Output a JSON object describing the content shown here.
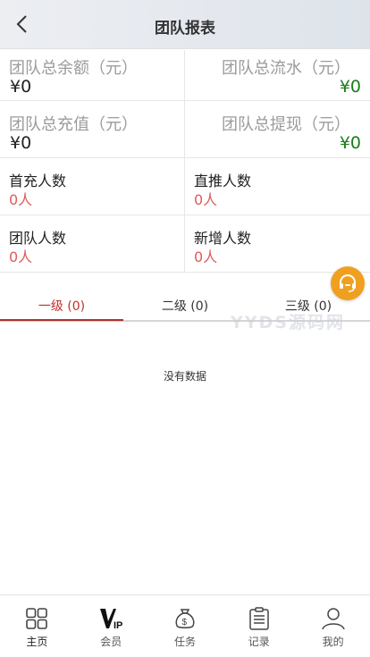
{
  "header": {
    "title": "团队报表"
  },
  "money_stats": [
    {
      "label": "团队总余额（元）",
      "value": "¥0"
    },
    {
      "label": "团队总流水（元）",
      "value": "¥0"
    },
    {
      "label": "团队总充值（元）",
      "value": "¥0"
    },
    {
      "label": "团队总提现（元）",
      "value": "¥0"
    }
  ],
  "count_stats": [
    {
      "label": "首充人数",
      "value": "0人"
    },
    {
      "label": "直推人数",
      "value": "0人"
    },
    {
      "label": "团队人数",
      "value": "0人"
    },
    {
      "label": "新增人数",
      "value": "0人"
    }
  ],
  "tabs": [
    {
      "label": "一级 (0)",
      "active": true
    },
    {
      "label": "二级 (0)",
      "active": false
    },
    {
      "label": "三级 (0)",
      "active": false
    }
  ],
  "watermark": "YYDS源码网",
  "empty_text": "没有数据",
  "tabbar": [
    {
      "label": "主页",
      "icon": "grid-icon",
      "active": true
    },
    {
      "label": "会员",
      "icon": "vip-icon",
      "active": false
    },
    {
      "label": "任务",
      "icon": "money-bag-icon",
      "active": false
    },
    {
      "label": "记录",
      "icon": "clipboard-icon",
      "active": false
    },
    {
      "label": "我的",
      "icon": "user-icon",
      "active": false
    }
  ],
  "colors": {
    "accent": "#c0302b",
    "positive": "#1b7d1b",
    "count": "#e05a5a",
    "service": "#f0a020"
  }
}
